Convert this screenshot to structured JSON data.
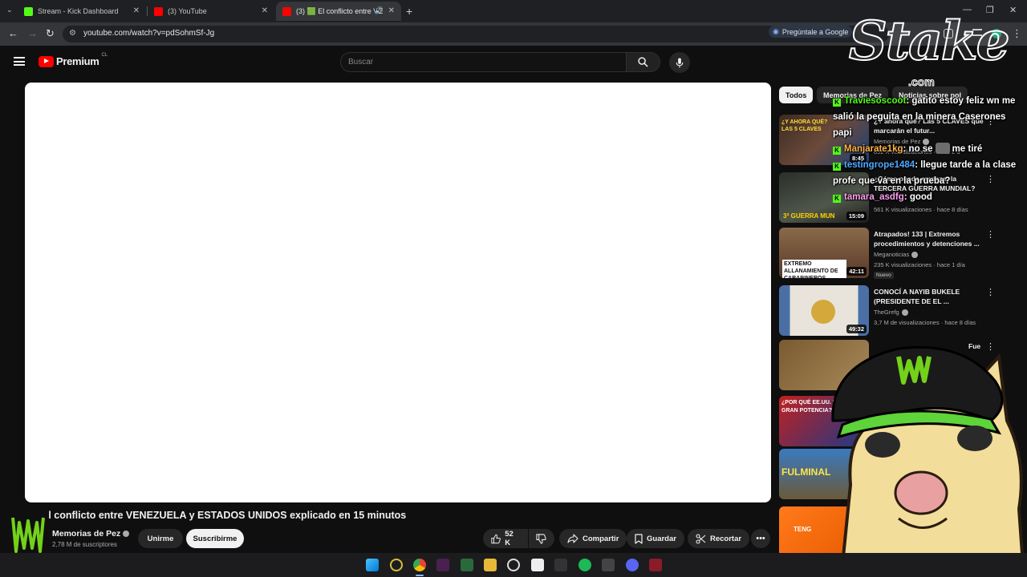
{
  "browser": {
    "tabs": [
      {
        "label": "Stream - Kick Dashboard",
        "close": "✕"
      },
      {
        "label": "(3) YouTube",
        "close": "✕"
      },
      {
        "label": "(3) 🟩 El conflicto entre VE",
        "close": "✕",
        "active": true
      }
    ],
    "new_tab": "+",
    "url": "youtube.com/watch?v=pdSohmSf-Jg",
    "ask_google": "Pregúntale a Google"
  },
  "youtube": {
    "brand": "Premium",
    "region": "CL",
    "search_placeholder": "Buscar",
    "video": {
      "title": "El conflicto entre VENEZUELA y ESTADOS UNIDOS explicado en 15 minutos",
      "channel": "Memorias de Pez",
      "subscribers": "2,78 M de suscriptores",
      "join_label": "Unirme",
      "subscribe_label": "Suscribirme",
      "likes": "52 K",
      "share_label": "Compartir",
      "save_label": "Guardar",
      "clip_label": "Recortar"
    },
    "chips": [
      "Todos",
      "Memorias de Pez",
      "Noticias sobre pol"
    ],
    "recommendations": [
      {
        "title": "¿Y ahora qué? Las 5 CLAVES que marcarán el futur...",
        "channel": "Memorias de Pez",
        "meta": "852 K visualizaciones · hace 2 d",
        "duration": "8:45",
        "thumb_text": "¿Y AHORA QUÉ? LAS 5 CLAVES"
      },
      {
        "title": "¿Cómo puede empezar la TERCERA GUERRA MUNDIAL?",
        "channel": "",
        "meta": "561 K visualizaciones · hace 8 días",
        "duration": "15:09",
        "thumb_text": "3ª GUERRA MUN"
      },
      {
        "title": "Atrapados! 133 | Extremos procedimientos y detenciones ...",
        "channel": "Meganoticias",
        "meta": "235 K visualizaciones · hace 1 día",
        "duration": "42:11",
        "badge": "Nuevo",
        "thumb_text": "EXTREMO ALLANAMIENTO DE CARABINEROS"
      },
      {
        "title": "CONOCÍ A NAYIB BUKELE (PRESIDENTE DE EL ...",
        "channel": "TheGrefg",
        "meta": "3,7 M de visualizaciones · hace 8 días",
        "duration": "49:32",
        "thumb_text": ""
      },
      {
        "title": "Fue",
        "channel": "",
        "meta": "",
        "duration": "",
        "thumb_text": ""
      },
      {
        "title": "",
        "channel": "",
        "meta": "",
        "duration": "",
        "thumb_text": "¿POR QUÉ EE.UU. ES LA GRAN POTENCIA?"
      },
      {
        "title": "",
        "channel": "",
        "meta": "",
        "duration": "",
        "thumb_text": "FULMINAL"
      },
      {
        "title": "",
        "channel": "",
        "meta": "",
        "duration": "",
        "thumb_text": "TENG"
      }
    ]
  },
  "overlay": {
    "stake_logo": "Stake",
    "stake_domain": ".com",
    "chat": [
      {
        "user": "Traviesoscoot",
        "text": ": gatito estoy feliz wn me salió la peguita en la minera Caserones papi"
      },
      {
        "user": "Manjarate1kg",
        "text": ": no se",
        "suffix": "me tiré"
      },
      {
        "user": "testingrope1484",
        "text": ": llegue tarde a la clase profe que va en la prueba?"
      },
      {
        "user": "tamara_asdfg",
        "text": ": good"
      }
    ]
  },
  "colors": {
    "youtube_red": "#ff0000",
    "kick_green": "#53fc18",
    "background": "#0f0f0f"
  }
}
